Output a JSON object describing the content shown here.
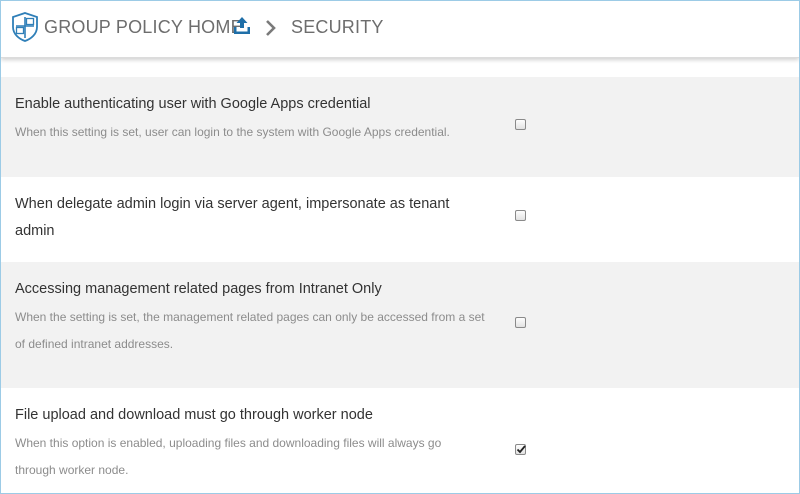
{
  "header": {
    "home_label": "GROUP POLICY HOME",
    "current_label": "SECURITY",
    "logo_icon": "shield-logo-icon",
    "upload_icon": "upload-icon",
    "separator_icon": "chevron-right-icon",
    "accent_color": "#1f6fa8"
  },
  "settings": [
    {
      "title": "Enable authenticating user with Google Apps credential",
      "description": "When this setting is set, user can login to the system with Google Apps credential.",
      "checked": false
    },
    {
      "title": "When delegate admin login via server agent, impersonate as tenant admin",
      "description": "",
      "checked": false
    },
    {
      "title": "Accessing management related pages from Intranet Only",
      "description": "When the setting is set, the management related pages can only be accessed from a set of defined intranet addresses.",
      "checked": false
    },
    {
      "title": "File upload and download must go through worker node",
      "description": "When this option is enabled, uploading files and downloading files will always go through worker node.",
      "checked": true
    }
  ]
}
